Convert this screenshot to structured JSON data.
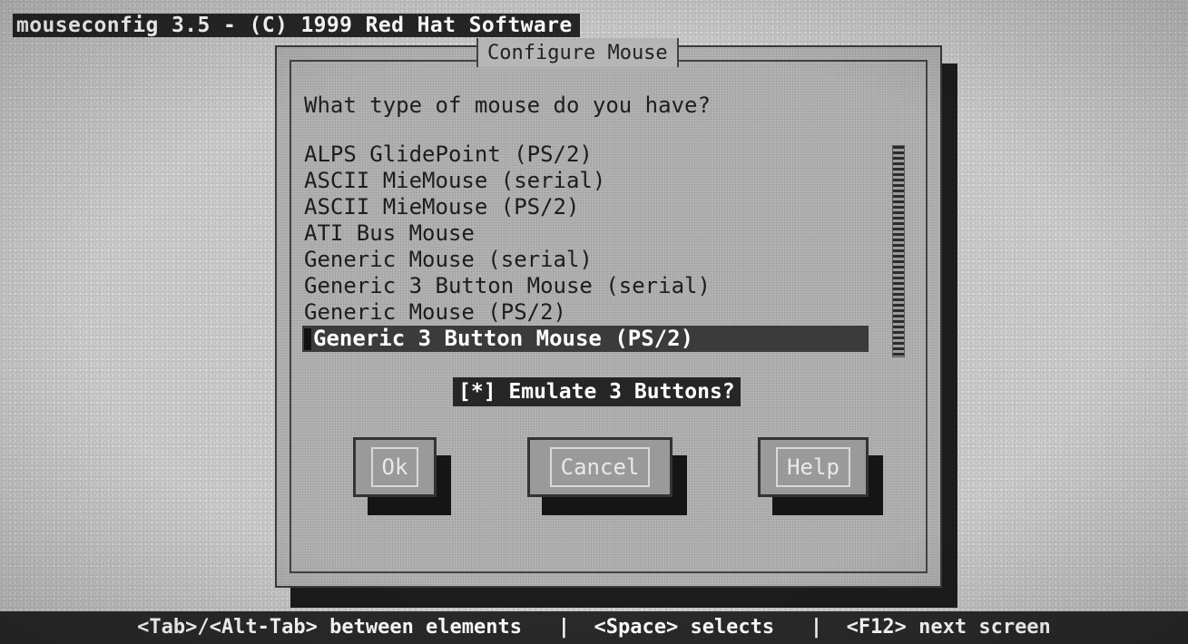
{
  "window": {
    "title": "mouseconfig 3.5 - (C) 1999 Red Hat Software"
  },
  "dialog": {
    "title": "Configure Mouse",
    "prompt": "What type of mouse do you have?"
  },
  "mouse_list": {
    "items": [
      "ALPS GlidePoint (PS/2)",
      "ASCII MieMouse (serial)",
      "ASCII MieMouse (PS/2)",
      "ATI Bus Mouse",
      "Generic Mouse (serial)",
      "Generic 3 Button Mouse (serial)",
      "Generic Mouse (PS/2)",
      "Generic 3 Button Mouse (PS/2)"
    ],
    "selected_index": 7
  },
  "options": {
    "emulate_checkbox": "[*] Emulate 3 Buttons?"
  },
  "buttons": {
    "ok": "Ok",
    "cancel": "Cancel",
    "help": "Help"
  },
  "status_bar": {
    "text": "<Tab>/<Alt-Tab> between elements   |  <Space> selects   |  <F12> next screen"
  },
  "colors": {
    "background": "#c9c9c9",
    "dialog": "#b6b6b6",
    "selection": "#3b3b3b",
    "status_bar": "#2a2a2a"
  }
}
